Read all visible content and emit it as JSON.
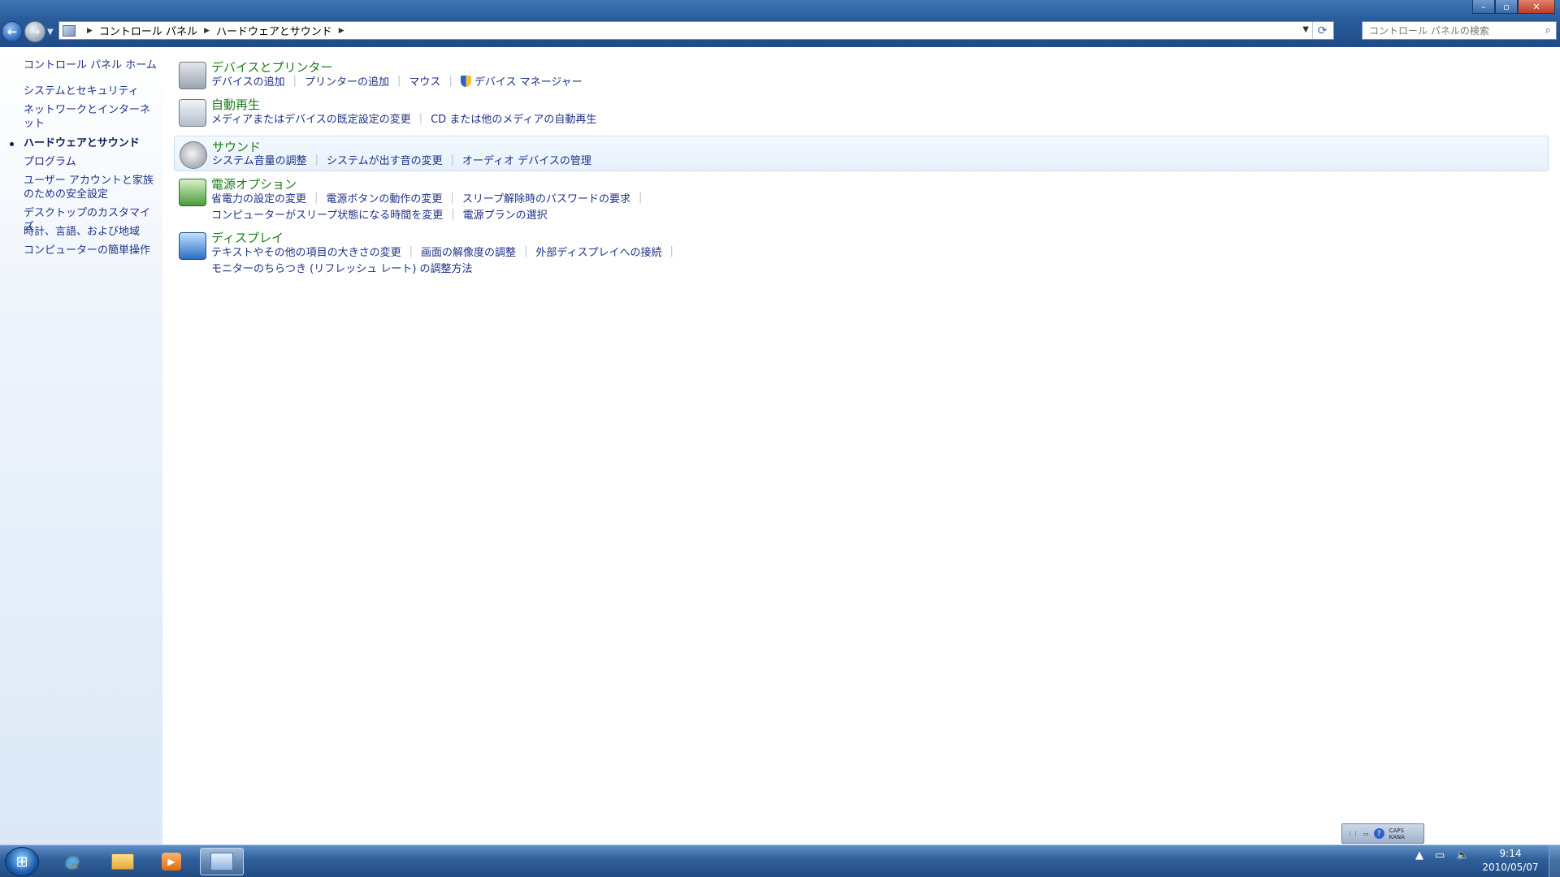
{
  "window": {
    "controls": [
      "minimize",
      "maximize",
      "close"
    ]
  },
  "address_bar": {
    "crumbs": [
      "コントロール パネル",
      "ハードウェアとサウンド"
    ]
  },
  "search": {
    "placeholder": "コントロール パネルの検索"
  },
  "left_pane": {
    "items": [
      {
        "label": "コントロール パネル ホーム",
        "current": false
      },
      {
        "label": "システムとセキュリティ",
        "current": false
      },
      {
        "label": "ネットワークとインターネット",
        "current": false
      },
      {
        "label": "ハードウェアとサウンド",
        "current": true
      },
      {
        "label": "プログラム",
        "current": false
      },
      {
        "label": "ユーザー アカウントと家族のための安全設定",
        "current": false
      },
      {
        "label": "デスクトップのカスタマイズ",
        "current": false
      },
      {
        "label": "時計、言語、および地域",
        "current": false
      },
      {
        "label": "コンピューターの簡単操作",
        "current": false
      }
    ]
  },
  "categories": [
    {
      "title": "デバイスとプリンター",
      "icon": "printer-icon",
      "links": [
        "デバイスの追加",
        "プリンターの追加",
        "マウス",
        "デバイス マネージャー"
      ]
    },
    {
      "title": "自動再生",
      "icon": "autoplay-icon",
      "links": [
        "メディアまたはデバイスの既定設定の変更",
        "CD または他のメディアの自動再生"
      ]
    },
    {
      "title": "サウンド",
      "icon": "speaker-icon",
      "links": [
        "システム音量の調整",
        "システムが出す音の変更",
        "オーディオ デバイスの管理"
      ]
    },
    {
      "title": "電源オプション",
      "icon": "power-options-icon",
      "links": [
        "省電力の設定の変更",
        "電源ボタンの動作の変更",
        "スリープ解除時のパスワードの要求"
      ],
      "links2": [
        "コンピューターがスリープ状態になる時間を変更",
        "電源プランの選択"
      ]
    },
    {
      "title": "ディスプレイ",
      "icon": "display-icon",
      "links": [
        "テキストやその他の項目の大きさの変更",
        "画面の解像度の調整",
        "外部ディスプレイへの接続"
      ],
      "links2": [
        "モニターのちらつき (リフレッシュ レート) の調整方法"
      ]
    }
  ],
  "taskbar": {
    "pinned": [
      "start-button",
      "internet-explorer",
      "windows-explorer",
      "media-player",
      "control-panel"
    ],
    "ime": {
      "caps": "CAPS",
      "kana": "KANA"
    },
    "clock": {
      "time": "9:14",
      "date": "2010/05/07"
    }
  }
}
